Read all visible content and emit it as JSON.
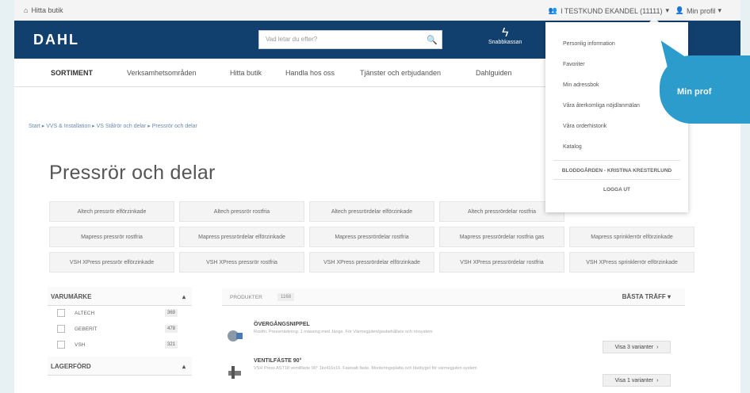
{
  "topbar": {
    "store": "Hitta butik",
    "account": "I TESTKUND EKANDEL (11111)",
    "profile": "Min profil"
  },
  "search": {
    "placeholder": "Vad letar du efter?"
  },
  "quick": {
    "label": "Snabbkassan"
  },
  "nav": [
    "SORTIMENT",
    "Verksamhetsområden",
    "Hitta butik",
    "Handla hos oss",
    "Tjänster och erbjudanden",
    "Dahlguiden"
  ],
  "breadcrumb": [
    "Start",
    "VVS & Installation",
    "VS Stålrör och delar",
    "Pressrör och delar"
  ],
  "page_title": "Pressrör och delar",
  "categories": [
    [
      "Altech pressrör elförzinkade",
      "Altech pressrör rostfria",
      "Altech pressrördelar elförzinkade",
      "Altech pressrördelar rostfria",
      ""
    ],
    [
      "Mapress pressrör rostfria",
      "Mapress pressrördelar elförzinkade",
      "Mapress pressrördelar rostfria",
      "Mapress pressrördelar rostfria gas",
      "Mapress sprinklerrör elförzinkade"
    ],
    [
      "VSH XPress pressrör elförzinkade",
      "VSH XPress pressrör rostfria",
      "VSH XPress pressrördelar elförzinkade",
      "VSH XPress pressrördelar rostfria",
      "VSH XPress sprinklerrör elförzinkade"
    ]
  ],
  "filters": {
    "brand_title": "VARUMÄRKE",
    "brands": [
      {
        "name": "ALTECH",
        "count": "369"
      },
      {
        "name": "GEBERIT",
        "count": "478"
      },
      {
        "name": "VSH",
        "count": "321"
      }
    ],
    "stock_title": "LAGERFÖRD"
  },
  "products_header": {
    "title": "PRODUKTER",
    "count": "1168",
    "sort": "BÄSTA TRÄFF"
  },
  "products": [
    {
      "name": "ÖVERGÅNGSNIPPEL",
      "desc": "Rostfri. Pressmärkning. 1 mässing med Jänge. För Värmegjuten/gasbehållare och rörsystem",
      "button": "Visa 3 varianter"
    },
    {
      "name": "VENTILFÄSTE 90°",
      "desc": "VSH Press AST18 ventilfäste 90° 1kx416x16. Fastsatt fäste. Monteringsplatta och fästbygel för värmegjuten system",
      "button": "Visa 1 varianter"
    }
  ],
  "dropdown": {
    "items": [
      "Personlig information",
      "Favoriter",
      "Min adressbok",
      "Våra återkomliga nöjd/anmälan",
      "Våra orderhistorik",
      "Katalog"
    ],
    "switch": "BLODDGÅRDEN - KRISTINA KRESTERLUND",
    "logout": "LOGGA UT"
  },
  "callout": "Min prof"
}
